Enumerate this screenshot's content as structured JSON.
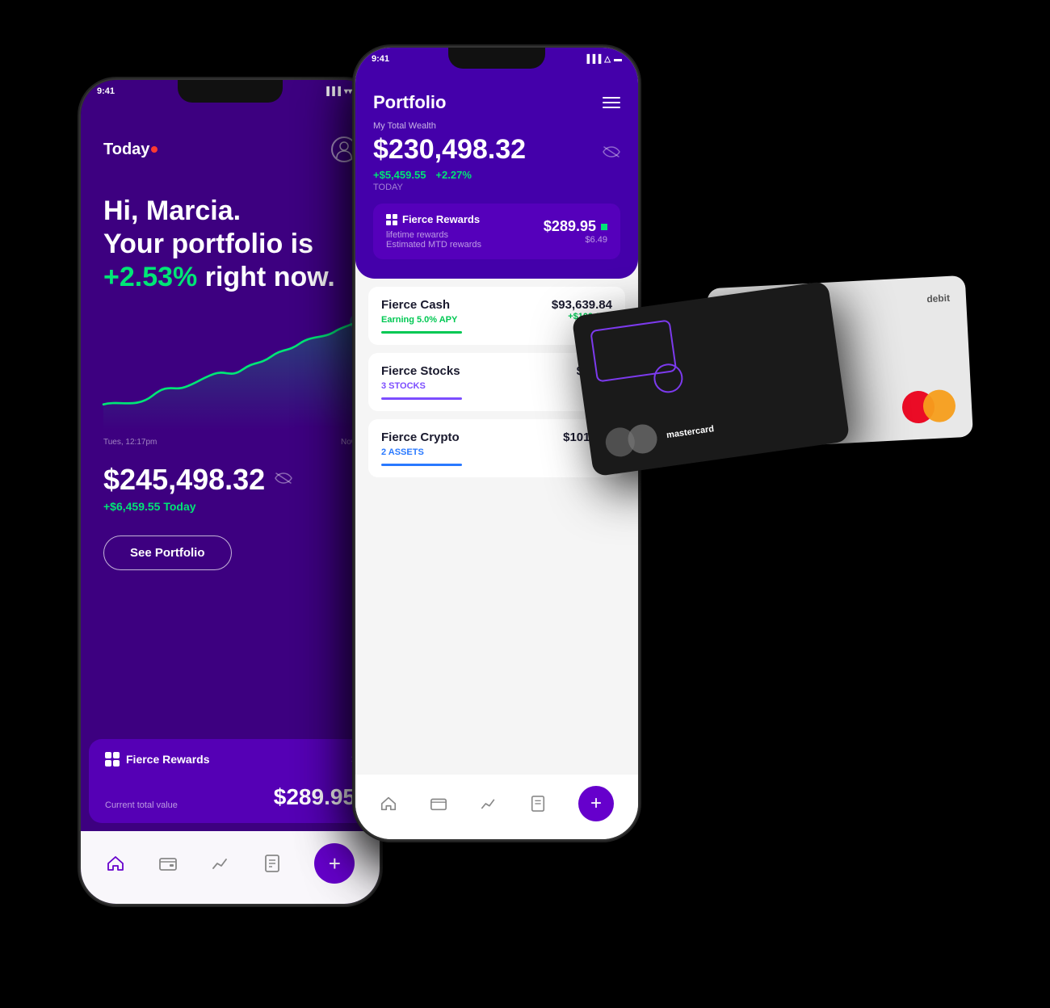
{
  "scene": {
    "bg_color": "#000000"
  },
  "phone_left": {
    "status_time": "9:41",
    "header_title": "Today",
    "avatar_icon": "person",
    "greeting_line1": "Hi, Marcia.",
    "greeting_line2": "Your portfolio is",
    "greeting_pct": "+2.53%",
    "greeting_line3": "right now.",
    "chart_label_left": "Tues, 12:17pm",
    "chart_label_right": "Now",
    "portfolio_value": "$245,498.32",
    "portfolio_change": "+$6,459.55 Today",
    "see_portfolio_label": "See Portfolio",
    "rewards_title": "Fierce Rewards",
    "rewards_amount": "$289.95",
    "rewards_label": "Current total value"
  },
  "phone_right": {
    "status_time": "9:41",
    "screen_title": "Portfolio",
    "wealth_label": "My Total Wealth",
    "wealth_value": "$230,498.32",
    "change_amount": "+$5,459.55",
    "change_pct": "+2.27%",
    "change_period": "TODAY",
    "rewards_title": "Fierce Rewards",
    "rewards_lifetime": "lifetime rewards",
    "rewards_mtd": "Estimated MTD rewards",
    "rewards_amount": "$289.95",
    "rewards_mtd_value": "$6.49",
    "items": [
      {
        "name": "Fierce Cash",
        "tag": "Earning 5.0% APY",
        "tag_color": "green",
        "value": "$93,639.84",
        "change": "+$109.20 ↑",
        "bar_color": "#00c853"
      },
      {
        "name": "Fierce Stocks",
        "tag": "3 STOCKS",
        "tag_color": "purple",
        "value": "$51,…",
        "change": "",
        "bar_color": "#7c4dff"
      },
      {
        "name": "Fierce Crypto",
        "tag": "2 ASSETS",
        "tag_color": "blue",
        "value": "$101,8…",
        "change": "",
        "bar_color": "#2979ff"
      }
    ]
  },
  "card_black": {
    "type": "debit",
    "brand": "mastercard"
  },
  "card_white": {
    "type": "debit",
    "debit_label": "debit",
    "brand": "mastercard"
  },
  "nav": {
    "items": [
      "home",
      "wallet",
      "chart",
      "document",
      "plus"
    ]
  }
}
